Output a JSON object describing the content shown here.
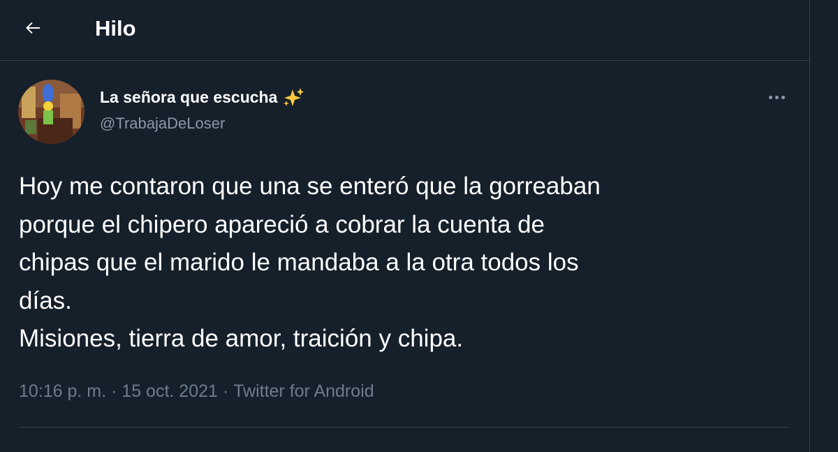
{
  "header": {
    "back_icon": "arrow-left-icon",
    "title": "Hilo"
  },
  "tweet": {
    "author": {
      "name": "La señora que escucha",
      "name_emoji": "sparkles-icon",
      "handle": "@TrabajaDeLoser",
      "avatar": "avatar-image"
    },
    "more_icon": "more-horizontal-icon",
    "text": "Hoy me contaron que una se enteró que la gorreaban\nporque el chipero apareció a cobrar la cuenta de\nchipas que el marido le mandaba a la otra todos los\ndías.\nMisiones, tierra de amor, traición y chipa.",
    "time": "10:16 p. m.",
    "date": "15 oct. 2021",
    "source": "Twitter for Android",
    "separator": " · "
  },
  "colors": {
    "background": "#15202b",
    "border": "#38444d",
    "text_primary": "#ffffff",
    "text_secondary": "#8b98a5",
    "meta_text": "#6e7c8a",
    "sparkles": "#ffc93d"
  }
}
